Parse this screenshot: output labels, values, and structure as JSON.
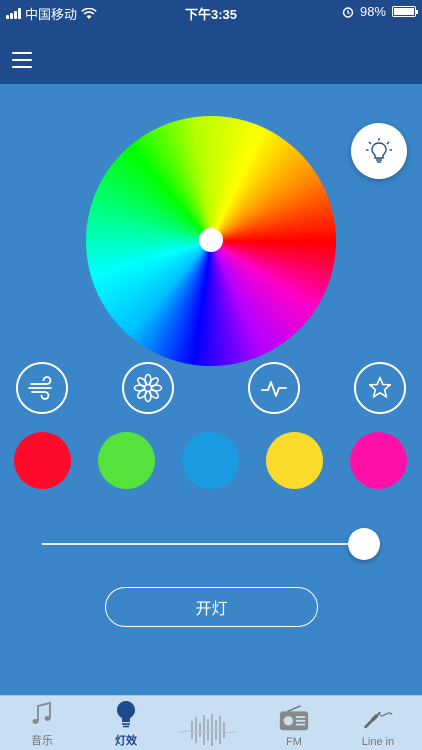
{
  "status": {
    "carrier": "中国移动",
    "time": "下午3:35",
    "battery": "98%",
    "battery_level": 0.98
  },
  "controls": {
    "brightness": 1.0,
    "power_label": "开灯"
  },
  "modes": [
    {
      "icon": "wind-icon"
    },
    {
      "icon": "flower-icon"
    },
    {
      "icon": "pulse-icon"
    },
    {
      "icon": "star-icon"
    }
  ],
  "swatches": [
    "#ff0a2b",
    "#55e33b",
    "#1a9ae0",
    "#fada2a",
    "#ff10a8"
  ],
  "tabs": [
    {
      "label": "音乐",
      "icon": "music-note-icon",
      "active": false
    },
    {
      "label": "灯效",
      "icon": "bulb-icon",
      "active": true
    },
    {
      "label": "",
      "icon": "waveform-icon",
      "active": false
    },
    {
      "label": "FM",
      "icon": "radio-icon",
      "active": false
    },
    {
      "label": "Line in",
      "icon": "audio-jack-icon",
      "active": false
    }
  ],
  "colors": {
    "nav": "#1f4a8c",
    "background": "#3a86c8",
    "tab_bar": "#c8def2",
    "active_tab": "#1f4a8c"
  }
}
